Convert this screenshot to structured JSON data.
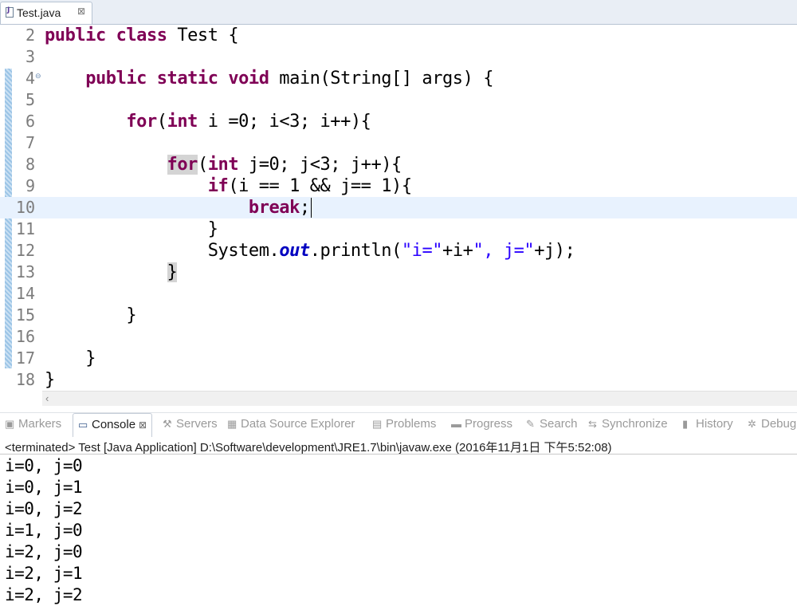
{
  "editor_tab": {
    "label": "Test.java",
    "close_glyph": "⊠"
  },
  "editor": {
    "line_numbers": [
      "2",
      "3",
      "4",
      "5",
      "6",
      "7",
      "8",
      "9",
      "10",
      "11",
      "12",
      "13",
      "14",
      "15",
      "16",
      "17",
      "18"
    ],
    "fold_glyph": "⊖",
    "code": {
      "l2_kw": "public class",
      "l2_rest": " Test {",
      "l4_kw": "public static void",
      "l4_rest": " main(String[] args) {",
      "l6_kw1": "for",
      "l6_a": "(",
      "l6_kw2": "int",
      "l6_b": " i =0; i<3; i++){",
      "l8_kw1": "for",
      "l8_a": "(",
      "l8_kw2": "int",
      "l8_b": " j=0; j<3; j++){",
      "l9_kw": "if",
      "l9_rest": "(i == 1 && j== 1){",
      "l10_kw": "break",
      "l10_rest": ";",
      "l11": "}",
      "l12_a": "System.",
      "l12_field": "out",
      "l12_b": ".println(",
      "l12_s1": "\"i=\"",
      "l12_c": "+i+",
      "l12_s2": "\", j=\"",
      "l12_d": "+j);",
      "l13": "}",
      "l15": "}",
      "l17": "}",
      "l18": "}"
    },
    "current_line": "10"
  },
  "views": {
    "tabs": [
      {
        "label": "Markers",
        "icon": "markers-icon",
        "glyph": "▣"
      },
      {
        "label": "Console",
        "icon": "console-icon",
        "glyph": "▭",
        "active": true
      },
      {
        "label": "Servers",
        "icon": "servers-icon",
        "glyph": "⚒"
      },
      {
        "label": "Data Source Explorer",
        "icon": "data-source-icon",
        "glyph": "▦"
      },
      {
        "label": "Problems",
        "icon": "problems-icon",
        "glyph": "▤"
      },
      {
        "label": "Progress",
        "icon": "progress-icon",
        "glyph": "▬"
      },
      {
        "label": "Search",
        "icon": "search-icon",
        "glyph": "✎"
      },
      {
        "label": "Synchronize",
        "icon": "synchronize-icon",
        "glyph": "⇆"
      },
      {
        "label": "History",
        "icon": "history-icon",
        "glyph": "▮"
      },
      {
        "label": "Debug",
        "icon": "debug-icon",
        "glyph": "✲"
      }
    ],
    "close_glyph": "⊠"
  },
  "console": {
    "status": "<terminated> Test [Java Application] D:\\Software\\development\\JRE1.7\\bin\\javaw.exe (2016年11月1日 下午5:52:08)",
    "lines": [
      "i=0, j=0",
      "i=0, j=1",
      "i=0, j=2",
      "i=1, j=0",
      "i=2, j=0",
      "i=2, j=1",
      "i=2, j=2"
    ]
  },
  "colors": {
    "keyword": "#7f0055",
    "string": "#2a00ff",
    "field": "#0000c0",
    "current_line": "#e8f2fe"
  }
}
